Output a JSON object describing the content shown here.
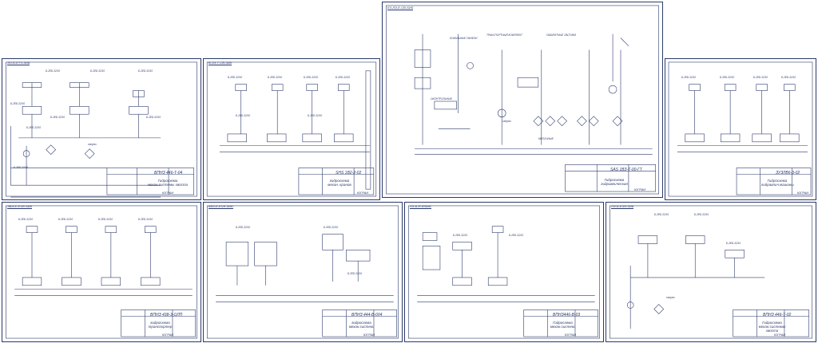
{
  "sheets": [
    {
      "id": "s1",
      "header": "ЭО-Б-ЕТЧ-SИБ",
      "code": "ВПНЗ 446-Т-04",
      "title": [
        "Гидросхема",
        "механ.системы хвоста"
      ],
      "org": "ЮГРАИ",
      "labels": [
        "Б-2ЕБ-32/10",
        "Б-2ЕБ-32/10",
        "Б-2ЕБ-32/10",
        "Б-2ЕБ-32/10",
        "Б-2ЕБ-32/10",
        "Б-2ЕБ-32/10",
        "Б-2ЕБ-32/10",
        "Б-2ЕБ-32/10",
        "сапуны"
      ]
    },
    {
      "id": "s2",
      "header": "В-ЗЭ-Т-СВ-ЗИБ",
      "code": "SHS 1В2-2-02",
      "title": [
        "гидросхема",
        "механ. кранов"
      ],
      "org": "ЮГРАИ",
      "labels": [
        "Б-2ЕБ-32/10",
        "Б-2ЕБ-32/10",
        "Б-2ЕБ-32/10",
        "Б-2ЕБ-32/10",
        "Б-2ЕБ-32/10",
        "Б-2ЕБ-32/10"
      ]
    },
    {
      "id": "s3",
      "header": "ЕЗ-ЛЭ-Е-СВ-SИS",
      "code": "SAS 1ВЗ-Т-00-ГТ",
      "title": [
        "Гидросхема",
        "гидравлическая"
      ],
      "org": "ЮГРАИ",
      "labels": [
        "ТРАНСПОРТНЫЙ КОМПЛЕКТ",
        "ГАБАРИТНЫЕ ЛАСТИКИ",
        "ЛОКАЛЬНЫЕ ПАНЕЛИ",
        "ОКОНТРОЛЬНЫЕ",
        "МЕЛОЧНЫЕ",
        "сапуны"
      ]
    },
    {
      "id": "s4",
      "header": "",
      "code": "ЗУЗЛВ6-3-02",
      "title": [
        "Гидросхема",
        "гидравлич.машины"
      ],
      "org": "ЮГРАИ",
      "labels": [
        "Б-2ЕБ-32/10",
        "Б-2ЕБ-32/10",
        "Б-2ЕБ-32/10",
        "Б-2ЕБ-32/10"
      ]
    },
    {
      "id": "s5",
      "header": "ЭВЭ-Е-ЕЧЯ-SИБ",
      "code": "ВПНЗ 438-3-ОЛП",
      "title": [
        "гидросхема",
        "транспортер"
      ],
      "org": "ЮГРАИ",
      "labels": [
        "Б-2ЕБ-32/10",
        "Б-2ЕБ-32/10",
        "Б-2ЕБ-32/10",
        "Б-2ЕБ-32/10"
      ]
    },
    {
      "id": "s6",
      "header": "КВЭ-Е-ЕЧЯ-SИБ",
      "code": "ВПНЗ 444-В-004",
      "title": [
        "гидросхема",
        "механ.систем."
      ],
      "org": "ЮГРАИ",
      "labels": [
        "Б-2ЕБ-32/10",
        "Б-2ЕБ-32/10",
        "Б-2ЕБ-32/10"
      ]
    },
    {
      "id": "s7",
      "header": "ЗЭ-Б-ЕЧЯSИБ",
      "code": "ВПНЗ446-В-03",
      "title": [
        "Гидросхема",
        "механ.систем."
      ],
      "org": "ЮГРАИ",
      "labels": [
        "Б-2ЕБ-32/10",
        "Б-2ЕБ-32/10"
      ]
    },
    {
      "id": "s8",
      "header": "ЛЭ-Б-ЕЧЯ-SИБ",
      "code": "ВПНЗ 446-Т-02",
      "title": [
        "Гидросхема",
        "механ.системы хвоста"
      ],
      "org": "ЮГРАИ",
      "labels": [
        "Б-2ЕБ-32/10",
        "Б-2ЕБ-32/10",
        "Б-2ЕБ-32/10",
        "сапуны"
      ]
    }
  ]
}
